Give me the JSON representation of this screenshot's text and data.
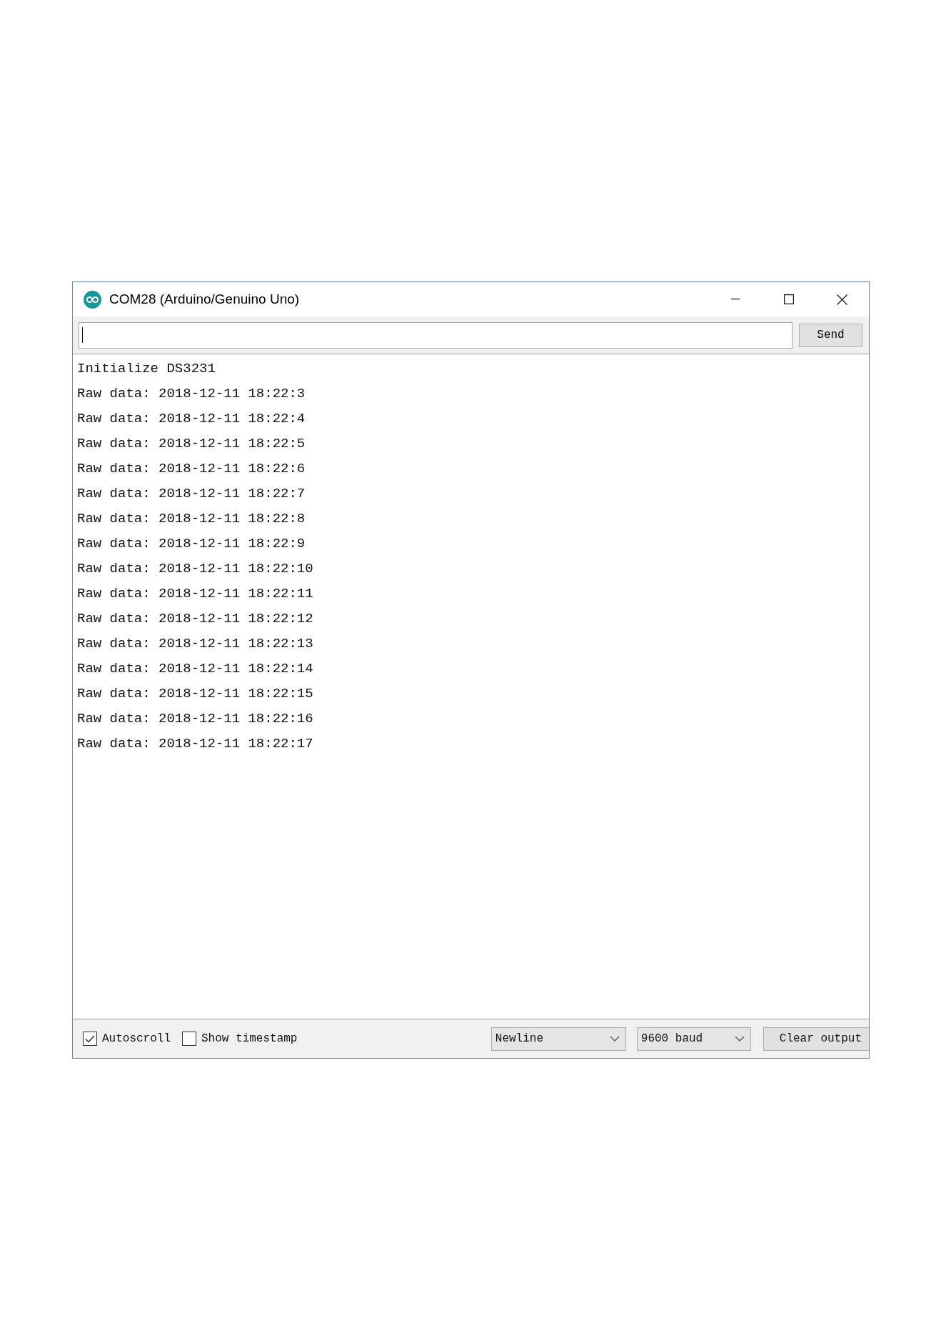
{
  "window": {
    "title": "COM28 (Arduino/Genuino Uno)"
  },
  "send_bar": {
    "button": "Send"
  },
  "output": {
    "lines": [
      "Initialize DS3231",
      "Raw data: 2018-12-11 18:22:3",
      "Raw data: 2018-12-11 18:22:4",
      "Raw data: 2018-12-11 18:22:5",
      "Raw data: 2018-12-11 18:22:6",
      "Raw data: 2018-12-11 18:22:7",
      "Raw data: 2018-12-11 18:22:8",
      "Raw data: 2018-12-11 18:22:9",
      "Raw data: 2018-12-11 18:22:10",
      "Raw data: 2018-12-11 18:22:11",
      "Raw data: 2018-12-11 18:22:12",
      "Raw data: 2018-12-11 18:22:13",
      "Raw data: 2018-12-11 18:22:14",
      "Raw data: 2018-12-11 18:22:15",
      "Raw data: 2018-12-11 18:22:16",
      "Raw data: 2018-12-11 18:22:17"
    ]
  },
  "footer": {
    "checkboxes": [
      {
        "label": "Autoscroll",
        "checked": true
      },
      {
        "label": "Show timestamp",
        "checked": false
      }
    ],
    "dropdowns": [
      {
        "value": "Newline"
      },
      {
        "value": "9600 baud"
      }
    ],
    "button": "Clear output"
  }
}
